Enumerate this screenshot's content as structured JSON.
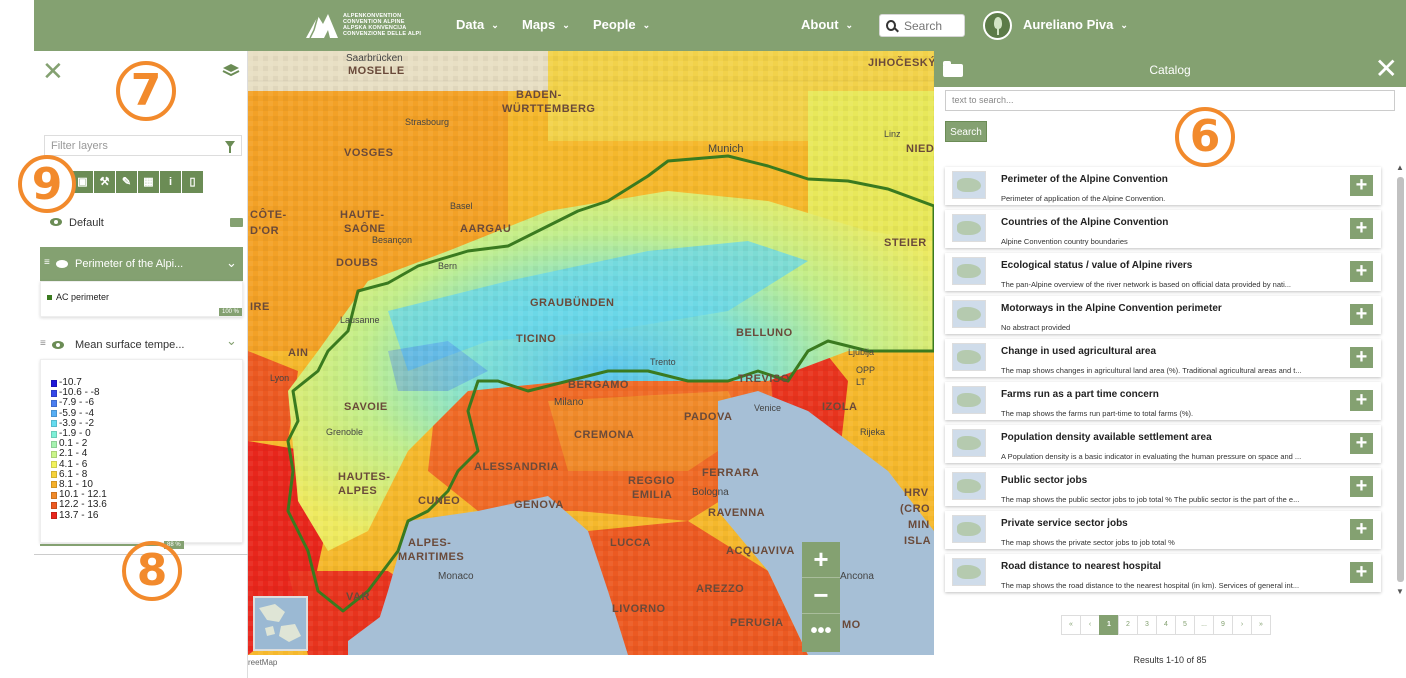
{
  "nav": {
    "logo_lines": [
      "ALPENKONVENTION",
      "CONVENTION ALPINE",
      "ALPSKA KONVENCIJA",
      "CONVENZIONE DELLE ALPI"
    ],
    "items": [
      {
        "label": "Data"
      },
      {
        "label": "Maps"
      },
      {
        "label": "People"
      }
    ],
    "about": "About",
    "search_placeholder": "Search",
    "user_name": "Aureliano Piva",
    "color": "#84a171"
  },
  "annotations": {
    "catalog_marker": "6",
    "panel_marker": "7",
    "legend_marker": "8",
    "toolbar_marker": "9"
  },
  "left_panel": {
    "filter_placeholder": "Filter layers",
    "group_name": "Default",
    "layer1": {
      "title": "Perimeter of the Alpi...",
      "legend_label": "AC perimeter",
      "opacity": "100 %"
    },
    "layer2": {
      "title": "Mean surface tempe...",
      "opacity": "88 %",
      "legend": [
        {
          "label": "-10.7",
          "color": "#1f18d8"
        },
        {
          "label": "-10.6 - -8",
          "color": "#3548e8"
        },
        {
          "label": "-7.9 - -6",
          "color": "#4b7ef0"
        },
        {
          "label": "-5.9 - -4",
          "color": "#57aef4"
        },
        {
          "label": "-3.9 - -2",
          "color": "#66dcf0"
        },
        {
          "label": "-1.9 - 0",
          "color": "#7ff0d8"
        },
        {
          "label": "0.1 - 2",
          "color": "#a6f2b0"
        },
        {
          "label": "2.1 - 4",
          "color": "#caf58a"
        },
        {
          "label": "4.1 - 6",
          "color": "#f2f25c"
        },
        {
          "label": "6.1 - 8",
          "color": "#f6d23a"
        },
        {
          "label": "8.1 - 10",
          "color": "#f5b02a"
        },
        {
          "label": "10.1 - 12.1",
          "color": "#f08a2a"
        },
        {
          "label": "12.2 - 13.6",
          "color": "#ec5a22"
        },
        {
          "label": "13.7 - 16",
          "color": "#e8261c"
        }
      ]
    }
  },
  "map": {
    "labels": {
      "saarbrucken": "Saarbrücken",
      "moselle": "MOSELLE",
      "jihocesky": "JIHOČESKÝ",
      "baden": "BADEN-",
      "wurttemberg": "WÜRTTEMBERG",
      "munich": "Munich",
      "vosges": "VOSGES",
      "strasbourg": "Strasbourg",
      "basel": "Basel",
      "aargau": "AARGAU",
      "hautes_saone_1": "HAUTE-",
      "hautes_saone_2": "SAÔNE",
      "cote": "CÔTE-",
      "dor": "D'OR",
      "besancon": "Besançon",
      "doubs": "DOUBS",
      "bern": "Bern",
      "graubunden": "GRAUBÜNDEN",
      "lausanne": "Lausanne",
      "ticino": "TICINO",
      "belluno": "BELLUNO",
      "trento": "Trento",
      "ain": "AIN",
      "lyon": "Lyon",
      "ire": "IRE",
      "savoie": "SAVOIE",
      "bergamo": "BERGAMO",
      "treviso": "TREVISO",
      "milano": "Milano",
      "padova": "PADOVA",
      "venice": "Venice",
      "izola": "IZOLA",
      "cremona": "CREMONA",
      "grenoble": "Grenoble",
      "hautes_alpes_1": "HAUTES-",
      "hautes_alpes_2": "ALPES",
      "cuneo": "CUNEO",
      "alessandria": "ALESSANDRIA",
      "reggio_1": "REGGIO",
      "reggio_2": "EMILIA",
      "ferrara": "FERRARA",
      "bologna": "Bologna",
      "genova": "GENOVA",
      "ravenna": "RAVENNA",
      "alpes_mar_1": "ALPES-",
      "alpes_mar_2": "MARITIMES",
      "var": "VAR",
      "monaco": "Monaco",
      "lucca": "LUCCA",
      "acquaviva": "ACQUAVIVA",
      "ancona": "Ancona",
      "livorno": "LIVORNO",
      "arezzo": "AREZZO",
      "perugia": "PERUGIA",
      "mo": "MO",
      "linz": "Linz",
      "nied": "NIED",
      "steier": "STEIER",
      "ljublja": "Ljublja",
      "hrv1": "HRV",
      "hrv2": "(CRO",
      "hrv3": "MIN",
      "hrv4": "ISLA",
      "rijeka": "Rijeka",
      "lt": "LT",
      "opp": "OPP"
    },
    "attribution": "reetMap"
  },
  "catalog": {
    "title": "Catalog",
    "search_placeholder": "text to search...",
    "search_button": "Search",
    "records": [
      {
        "title": "Perimeter of the Alpine Convention",
        "desc": "Perimeter of application of the Alpine Convention."
      },
      {
        "title": "Countries of the Alpine Convention",
        "desc": "Alpine Convention country boundaries"
      },
      {
        "title": "Ecological status / value of Alpine rivers",
        "desc": "The pan-Alpine overview of the river network is based on official data provided by nati..."
      },
      {
        "title": "Motorways in the Alpine Convention perimeter",
        "desc": "No abstract provided"
      },
      {
        "title": "Change in used agricultural area",
        "desc": "The map shows changes in agricultural land area (%). Traditional agricultural areas and t..."
      },
      {
        "title": "Farms run as a part time concern",
        "desc": "The map shows the farms run part-time to total farms (%)."
      },
      {
        "title": "Population density available settlement area",
        "desc": "A Population density is a basic indicator in evaluating the human pressure on space and ..."
      },
      {
        "title": "Public sector jobs",
        "desc": "The map shows the public sector jobs to job total % The public sector is the part of the e..."
      },
      {
        "title": "Private service sector jobs",
        "desc": "The map shows the private sector jobs to job total %"
      },
      {
        "title": "Road distance to nearest hospital",
        "desc": "The map shows the road distance to the nearest hospital (in km). Services of general int..."
      }
    ],
    "pager": [
      "«",
      "‹",
      "1",
      "2",
      "3",
      "4",
      "5",
      "...",
      "9",
      "›",
      "»"
    ],
    "pager_active": "1",
    "results": "Results 1-10 of 85"
  }
}
